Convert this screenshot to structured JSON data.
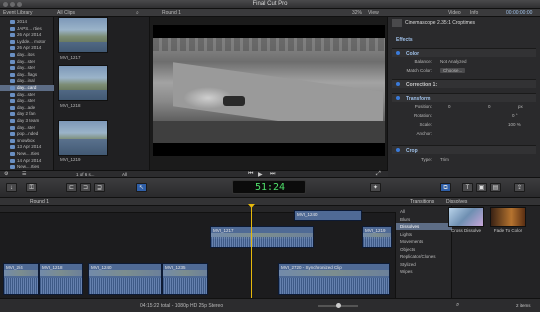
{
  "app": {
    "title": "Final Cut Pro"
  },
  "library": {
    "header": "Event Library",
    "items": [
      {
        "label": "2014",
        "selected": false
      },
      {
        "label": "JAPS... rties",
        "selected": false
      },
      {
        "label": "26 Apr 2014",
        "selected": false
      },
      {
        "label": "Lydde... motor",
        "selected": false
      },
      {
        "label": "26 Apr 2014",
        "selected": false
      },
      {
        "label": "day...itos",
        "selected": false
      },
      {
        "label": "day...ster",
        "selected": false
      },
      {
        "label": "day...ster",
        "selected": false
      },
      {
        "label": "day...flags",
        "selected": false
      },
      {
        "label": "day...inal",
        "selected": false
      },
      {
        "label": "day...card",
        "selected": true
      },
      {
        "label": "day...ster",
        "selected": false
      },
      {
        "label": "day...ster",
        "selected": false
      },
      {
        "label": "day...ade",
        "selected": false
      },
      {
        "label": "day 2 fan",
        "selected": false
      },
      {
        "label": "day 3 team",
        "selected": false
      },
      {
        "label": "day...ster",
        "selected": false
      },
      {
        "label": "pop...nded",
        "selected": false
      },
      {
        "label": "snowbox",
        "selected": false
      },
      {
        "label": "13 Apr 2014",
        "selected": false
      },
      {
        "label": "New....rties",
        "selected": false
      },
      {
        "label": "14 Apr 2014",
        "selected": false
      },
      {
        "label": "New....rties",
        "selected": false
      }
    ]
  },
  "browser": {
    "filter": "All Clips",
    "clips": [
      "MVI_1217",
      "MVI_1218",
      "MVI_1219"
    ],
    "footer_count": "1 of 6 s...",
    "footer_all": "All"
  },
  "viewer": {
    "title": "Round 1",
    "zoom": "32%",
    "view_menu": "View"
  },
  "inspector": {
    "tabs": [
      "Video",
      "Info"
    ],
    "timecode": "00:00:00:00",
    "clip_name": "Cinemascope 2.35:1 Croptimes",
    "effects_label": "Effects",
    "color": {
      "name": "Color",
      "balance_label": "Balance:",
      "balance_value": "Not Analyzed",
      "match_label": "Match Color:",
      "match_value": "Choose..."
    },
    "correction_label": "Correction 1:",
    "transform": {
      "name": "Transform",
      "position_label": "Position:",
      "x": "0",
      "y": "0",
      "unit": "px",
      "rotation_label": "Rotation:",
      "rotation_value": "0 °",
      "scale_label": "Scale:",
      "scale_value": "100 %",
      "anchor_label": "Anchor:"
    },
    "crop": {
      "name": "Crop",
      "type_label": "Type:",
      "type_value": "Trim"
    }
  },
  "toolbar": {
    "timecode": "51:24"
  },
  "timeline": {
    "project": "Round 1",
    "clips": [
      {
        "label": "MVI_1217",
        "track": 1
      },
      {
        "label": "MVI_1219",
        "track": 1
      },
      {
        "label": "MVI_2/4",
        "track": 2
      },
      {
        "label": "MVI_1218",
        "track": 2
      },
      {
        "label": "MVI_1240",
        "track": 2
      },
      {
        "label": "MVI_1235",
        "track": 2
      },
      {
        "label": "MVI_2720 - Synchronized Clip",
        "track": 2
      },
      {
        "label": "MVI_1240",
        "track": 0
      }
    ],
    "footer": "04:15:22 total - 1080p HD 25p Stereo"
  },
  "effects_browser": {
    "tab_left": "Transitions",
    "tab_right": "Dissolves",
    "categories": [
      "All",
      "Blurs",
      "Dissolves",
      "Lights",
      "Movements",
      "Objects",
      "Replicator/Clones",
      "Stylized",
      "Wipes"
    ],
    "selected": "Dissolves",
    "items": [
      "Cross Dissolve",
      "Fade To Color"
    ],
    "count": "2 items"
  },
  "colors": {
    "accent": "#3a7ad9",
    "timecode_green": "#4ee06a",
    "playhead": "#e5b80b",
    "selection": "#5d6d86"
  }
}
